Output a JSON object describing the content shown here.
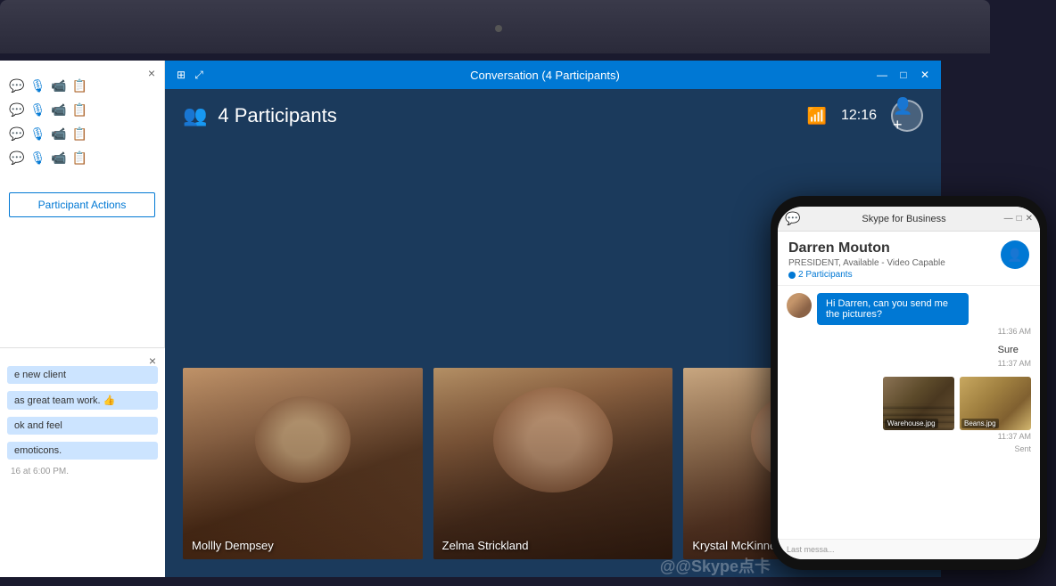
{
  "titlebar": {
    "title": "Conversation (4 Participants)",
    "minimize": "—",
    "restore": "□",
    "close": "✕"
  },
  "header": {
    "participants_count": "4 Participants",
    "time": "12:16"
  },
  "videos": [
    {
      "name": "Mollly Dempsey"
    },
    {
      "name": "Zelma Strickland"
    },
    {
      "name": "Krystal McKinney"
    }
  ],
  "left_panel": {
    "close_label": "×",
    "participant_rows": [
      {
        "icons": [
          "💬",
          "🎙",
          "📹",
          "📋"
        ]
      },
      {
        "icons": [
          "💬",
          "🎙",
          "📹",
          "📋"
        ]
      },
      {
        "icons": [
          "💬",
          "🎙",
          "📹",
          "📋"
        ]
      },
      {
        "icons": [
          "💬",
          "🎙",
          "📹",
          "📋"
        ]
      }
    ],
    "actions_button": "Participant Actions"
  },
  "chat_panel": {
    "close_label": "×",
    "messages": [
      "e new client",
      "as great team work. 👍",
      "ok and feel",
      "emoticons."
    ],
    "timestamp": "16 at 6:00 PM."
  },
  "phone": {
    "app_title": "Skype for Business",
    "win_min": "—",
    "win_restore": "□",
    "win_close": "✕",
    "contact_name": "Darren Mouton",
    "contact_status": "PRESIDENT, Available - Video Capable",
    "participants_label": "2 Participants",
    "messages": [
      {
        "text": "Hi Darren, can you send me the pictures?",
        "time": "11:36 AM",
        "type": "bubble"
      },
      {
        "text": "Sure",
        "time": "11:37 AM",
        "type": "plain"
      },
      {
        "attachments": [
          "Warehouse.jpg",
          "Beans.jpg"
        ],
        "time": "11:37 AM",
        "type": "images"
      }
    ],
    "sent_label": "Sent",
    "footer_text": "Last messa..."
  },
  "watermark": "@@Skype点卡"
}
